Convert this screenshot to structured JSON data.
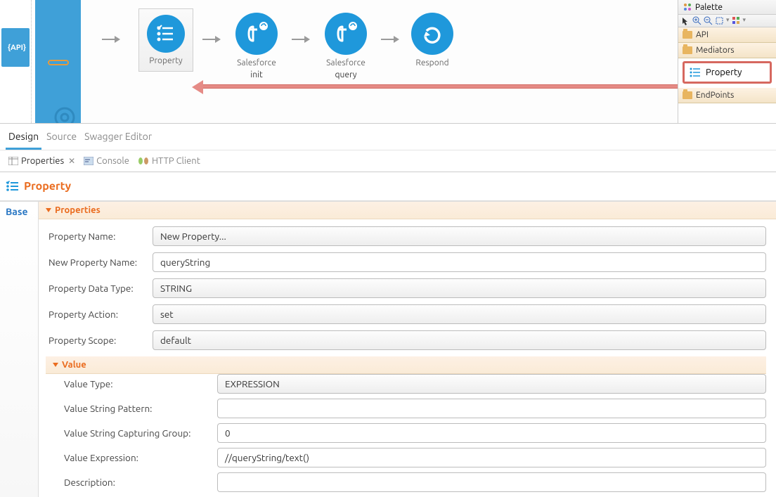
{
  "palette": {
    "title": "Palette",
    "folders": {
      "api": "API",
      "mediators": "Mediators",
      "endpoints": "EndPoints"
    },
    "item_property": "Property"
  },
  "nodes": {
    "property": "Property",
    "sf1": "Salesforce",
    "sf1_sub": "init",
    "sf2": "Salesforce",
    "sf2_sub": "query",
    "respond": "Respond"
  },
  "editor_tabs": {
    "design": "Design",
    "source": "Source",
    "swagger": "Swagger Editor"
  },
  "bottom_tabs": {
    "properties": "Properties",
    "console": "Console",
    "http": "HTTP Client"
  },
  "prop": {
    "header": "Property",
    "side_base": "Base",
    "section_properties": "Properties",
    "section_value": "Value",
    "labels": {
      "name": "Property Name:",
      "new_name": "New Property Name:",
      "data_type": "Property Data Type:",
      "action": "Property Action:",
      "scope": "Property Scope:",
      "value_type": "Value Type:",
      "vsp": "Value String Pattern:",
      "vscg": "Value String Capturing Group:",
      "vexp": "Value Expression:",
      "desc": "Description:"
    },
    "values": {
      "name": "New Property...",
      "new_name": "queryString",
      "data_type": "STRING",
      "action": "set",
      "scope": "default",
      "value_type": "EXPRESSION",
      "vsp": "",
      "vscg": "0",
      "vexp": "//queryString/text()",
      "desc": ""
    }
  }
}
